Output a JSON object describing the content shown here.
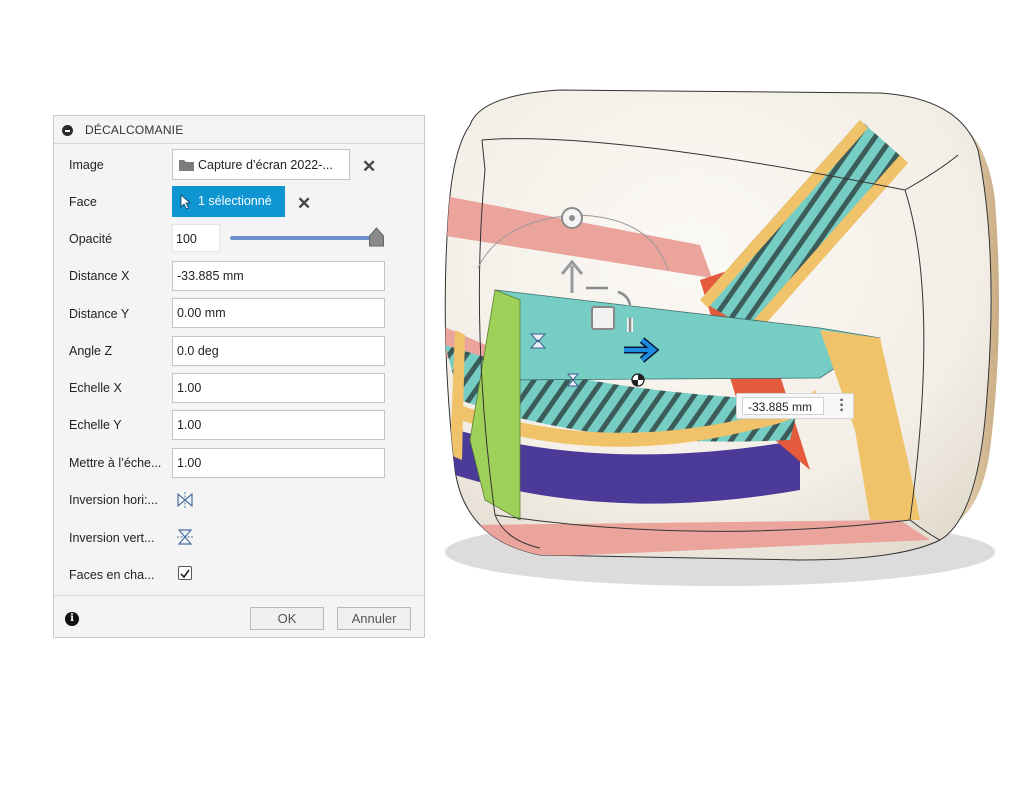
{
  "dialog": {
    "title": "DÉCALCOMANIE",
    "rows": {
      "image": {
        "label": "Image",
        "value": "Capture d’écran 2022-..."
      },
      "face": {
        "label": "Face",
        "value": "1 sélectionné"
      },
      "opacity": {
        "label": "Opacité",
        "value": "100",
        "level": 1.0
      },
      "distance_x": {
        "label": "Distance X",
        "value": "-33.885 mm"
      },
      "distance_y": {
        "label": "Distance Y",
        "value": "0.00 mm"
      },
      "angle_z": {
        "label": "Angle Z",
        "value": "0.0 deg"
      },
      "scale_x": {
        "label": "Echelle X",
        "value": "1.00"
      },
      "scale_y": {
        "label": "Echelle Y",
        "value": "1.00"
      },
      "fit": {
        "label": "Mettre à l’éche...",
        "value": "1.00"
      },
      "flip_h": {
        "label": "Inversion hori:..."
      },
      "flip_v": {
        "label": "Inversion vert..."
      },
      "chain_faces": {
        "label": "Faces en cha...",
        "checked": true
      }
    },
    "buttons": {
      "ok": "OK",
      "cancel": "Annuler"
    }
  },
  "viewport": {
    "dimension_value": "-33.885 mm"
  },
  "colors": {
    "accent_blue": "#0e96d3",
    "slider": "#6f91cc",
    "decal_teal": "#76cdc4",
    "decal_orange": "#f0c26a",
    "decal_salmon": "#eaa49c",
    "decal_purple": "#4b3a97",
    "decal_green": "#9fd15a",
    "body_cream": "#f6f2ec",
    "wood": "#dcc4a2"
  }
}
